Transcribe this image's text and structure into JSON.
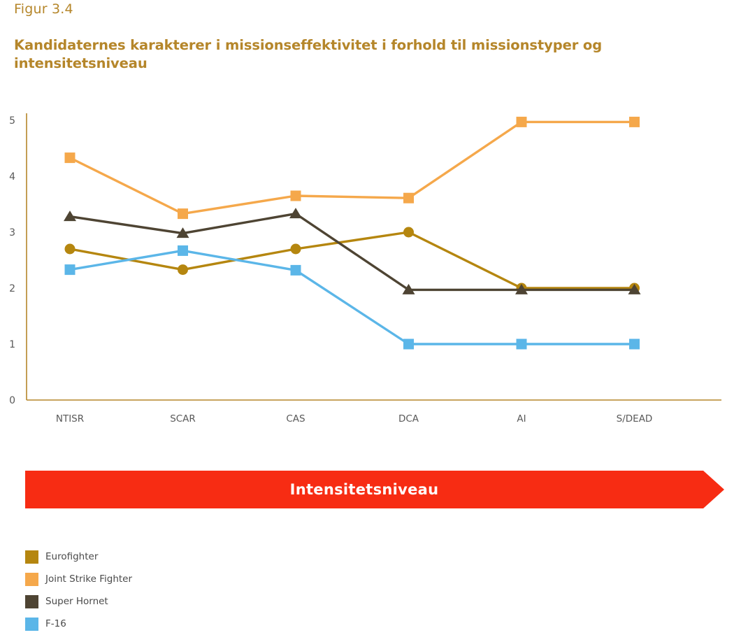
{
  "figure_label": "Figur 3.4",
  "title": "Kandidaternes karakterer i missionseffektivitet i forhold til missionstyper og intensitetsniveau",
  "banner": {
    "label": "Intensitetsniveau",
    "color": "#F72C13"
  },
  "colors": {
    "title": "#B5862A",
    "axis": "#B5862A",
    "tick_text": "#595959",
    "eurofighter": "#B5860F",
    "joint_strike_fighter": "#F5A84B",
    "super_hornet": "#4E4433",
    "f16": "#5BB6E8"
  },
  "legend": {
    "position": "below-chart",
    "items": [
      {
        "label": "Eurofighter",
        "color": "#B5860F",
        "marker": "circle"
      },
      {
        "label": "Joint Strike Fighter",
        "color": "#F5A84B",
        "marker": "square"
      },
      {
        "label": "Super Hornet",
        "color": "#4E4433",
        "marker": "triangle"
      },
      {
        "label": "F-16",
        "color": "#5BB6E8",
        "marker": "square"
      }
    ]
  },
  "chart_data": {
    "type": "line",
    "title": "Kandidaternes karakterer i missionseffektivitet i forhold til missionstyper og intensitetsniveau",
    "xlabel": "",
    "ylabel": "",
    "categories": [
      "NTISR",
      "SCAR",
      "CAS",
      "DCA",
      "AI",
      "S/DEAD"
    ],
    "yticks": [
      0,
      1,
      2,
      3,
      4,
      5
    ],
    "ylim": [
      0,
      5.25
    ],
    "grid": false,
    "legend_position": "bottom-left",
    "series": [
      {
        "name": "Eurofighter",
        "color": "#B5860F",
        "marker": "circle",
        "values": [
          2.7,
          2.33,
          2.7,
          3.0,
          2.0,
          2.0
        ]
      },
      {
        "name": "Joint Strike Fighter",
        "color": "#F5A84B",
        "marker": "square",
        "values": [
          4.33,
          3.33,
          3.65,
          3.61,
          4.97,
          4.97
        ]
      },
      {
        "name": "Super Hornet",
        "color": "#4E4433",
        "marker": "triangle",
        "values": [
          3.28,
          2.98,
          3.33,
          1.97,
          1.97,
          1.97
        ]
      },
      {
        "name": "F-16",
        "color": "#5BB6E8",
        "marker": "square",
        "values": [
          2.33,
          2.67,
          2.32,
          1.0,
          1.0,
          1.0
        ]
      }
    ]
  }
}
